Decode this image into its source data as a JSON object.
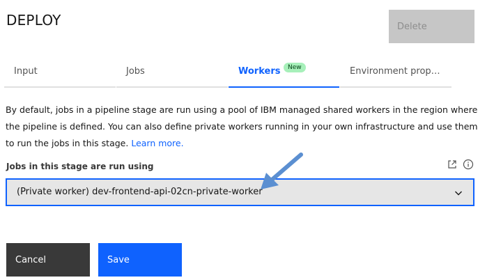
{
  "header": {
    "title": "DEPLOY",
    "delete_label": "Delete"
  },
  "tabs": [
    {
      "label": "Input",
      "active": false
    },
    {
      "label": "Jobs",
      "active": false
    },
    {
      "label": "Workers",
      "active": true,
      "badge": "New"
    },
    {
      "label": "Environment properties",
      "active": false
    }
  ],
  "description": {
    "text": "By default, jobs in a pipeline stage are run using a pool of IBM managed shared workers in the region where the pipeline is defined. You can also define private workers running in your own infrastructure and use them to run the jobs in this stage.",
    "link_label": "Learn more."
  },
  "worker_field": {
    "label": "Jobs in this stage are run using",
    "selected_value": "(Private worker) dev-frontend-api-02cn-private-worker",
    "icons": [
      "launch-icon",
      "info-icon",
      "chevron-down-icon"
    ]
  },
  "footer": {
    "cancel_label": "Cancel",
    "save_label": "Save"
  },
  "colors": {
    "accent": "#0f62fe",
    "badge_bg": "#a7f0ba",
    "annotation_arrow": "#5b8fd1"
  }
}
